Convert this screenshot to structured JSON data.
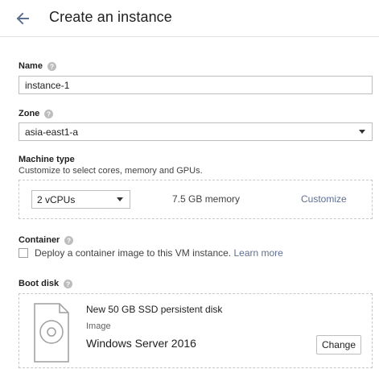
{
  "header": {
    "title": "Create an instance",
    "back_icon": "arrow-left-icon"
  },
  "name": {
    "label": "Name",
    "value": "instance-1"
  },
  "zone": {
    "label": "Zone",
    "value": "asia-east1-a"
  },
  "machine_type": {
    "label": "Machine type",
    "description": "Customize to select cores, memory and GPUs.",
    "cpu_value": "2 vCPUs",
    "memory": "7.5 GB memory",
    "customize_label": "Customize"
  },
  "container": {
    "label": "Container",
    "checkbox_text": "Deploy a container image to this VM instance.",
    "learn_more": "Learn more",
    "checked": false
  },
  "boot_disk": {
    "label": "Boot disk",
    "disk_summary": "New 50 GB SSD persistent disk",
    "image_label": "Image",
    "image_name": "Windows Server 2016",
    "change_label": "Change"
  },
  "colors": {
    "link": "#5f6f91",
    "border": "#bdbdbd",
    "dashed": "#c8c8c8",
    "help_icon": "#bdbdbd"
  }
}
